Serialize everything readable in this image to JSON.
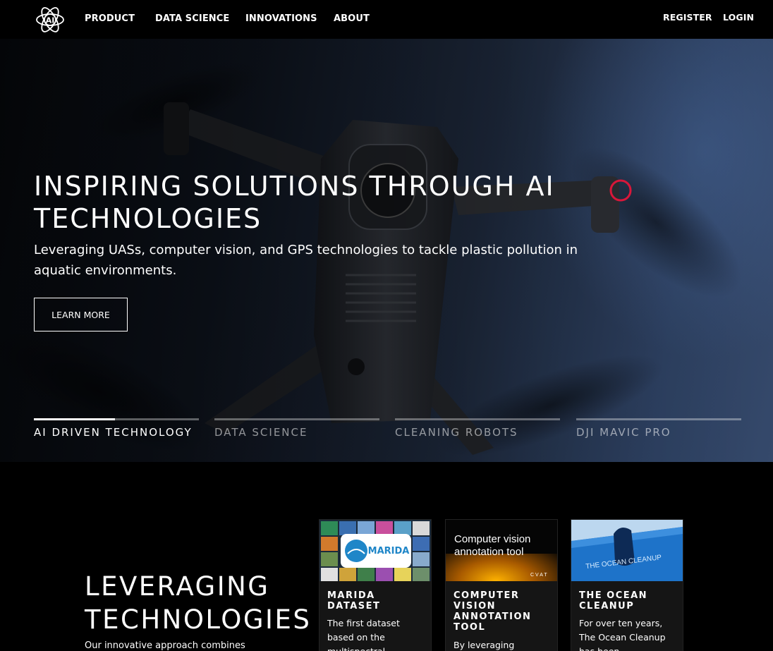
{
  "nav": {
    "logo_text": "AI",
    "items": [
      "PRODUCT",
      "DATA SCIENCE",
      "INNOVATIONS",
      "ABOUT"
    ],
    "register": "REGISTER",
    "login": "LOGIN"
  },
  "hero": {
    "title": "INSPIRING SOLUTIONS THROUGH AI TECHNOLOGIES",
    "subtitle": "Leveraging UASs, computer vision, and GPS technologies to tackle plastic pollution in aquatic environments.",
    "button": "LEARN MORE",
    "slides": [
      {
        "label": "AI DRIVEN TECHNOLOGY",
        "progress": 0.49,
        "active": true
      },
      {
        "label": "DATA SCIENCE",
        "progress": 0,
        "active": false
      },
      {
        "label": "CLEANING ROBOTS",
        "progress": 0,
        "active": false
      },
      {
        "label": "DJI MAVIC PRO",
        "progress": 0,
        "active": false
      }
    ]
  },
  "section": {
    "title_line1": "LEVERAGING",
    "title_line2": "TECHNOLOGIES",
    "subtitle": "Our innovative approach combines"
  },
  "cards": [
    {
      "image_badge": "MARIDA",
      "title": "MARIDA DATASET",
      "text": "The first dataset based on the multispectral"
    },
    {
      "image_line1": "Computer vision",
      "image_line2": "annotation tool",
      "image_footer": "CVAT",
      "title": "COMPUTER VISION ANNOTATION TOOL",
      "text": "By leveraging"
    },
    {
      "image_text": "THE OCEAN CLEANUP",
      "title": "THE OCEAN CLEANUP",
      "text": "For over ten years, The Ocean Cleanup has been"
    }
  ]
}
